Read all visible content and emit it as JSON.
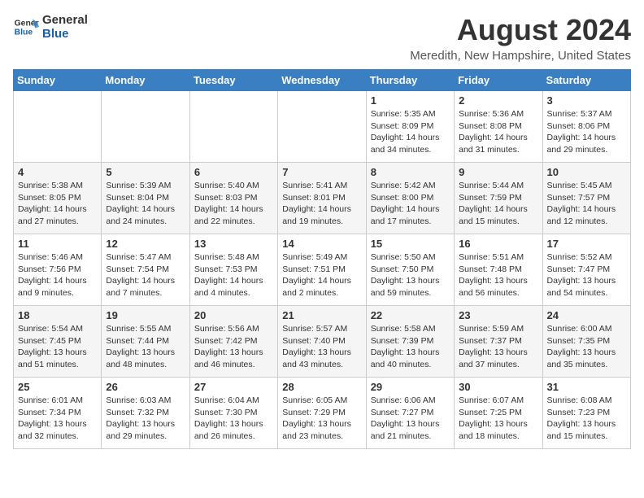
{
  "logo": {
    "line1": "General",
    "line2": "Blue"
  },
  "title": "August 2024",
  "location": "Meredith, New Hampshire, United States",
  "weekdays": [
    "Sunday",
    "Monday",
    "Tuesday",
    "Wednesday",
    "Thursday",
    "Friday",
    "Saturday"
  ],
  "weeks": [
    [
      {
        "day": "",
        "info": ""
      },
      {
        "day": "",
        "info": ""
      },
      {
        "day": "",
        "info": ""
      },
      {
        "day": "",
        "info": ""
      },
      {
        "day": "1",
        "info": "Sunrise: 5:35 AM\nSunset: 8:09 PM\nDaylight: 14 hours\nand 34 minutes."
      },
      {
        "day": "2",
        "info": "Sunrise: 5:36 AM\nSunset: 8:08 PM\nDaylight: 14 hours\nand 31 minutes."
      },
      {
        "day": "3",
        "info": "Sunrise: 5:37 AM\nSunset: 8:06 PM\nDaylight: 14 hours\nand 29 minutes."
      }
    ],
    [
      {
        "day": "4",
        "info": "Sunrise: 5:38 AM\nSunset: 8:05 PM\nDaylight: 14 hours\nand 27 minutes."
      },
      {
        "day": "5",
        "info": "Sunrise: 5:39 AM\nSunset: 8:04 PM\nDaylight: 14 hours\nand 24 minutes."
      },
      {
        "day": "6",
        "info": "Sunrise: 5:40 AM\nSunset: 8:03 PM\nDaylight: 14 hours\nand 22 minutes."
      },
      {
        "day": "7",
        "info": "Sunrise: 5:41 AM\nSunset: 8:01 PM\nDaylight: 14 hours\nand 19 minutes."
      },
      {
        "day": "8",
        "info": "Sunrise: 5:42 AM\nSunset: 8:00 PM\nDaylight: 14 hours\nand 17 minutes."
      },
      {
        "day": "9",
        "info": "Sunrise: 5:44 AM\nSunset: 7:59 PM\nDaylight: 14 hours\nand 15 minutes."
      },
      {
        "day": "10",
        "info": "Sunrise: 5:45 AM\nSunset: 7:57 PM\nDaylight: 14 hours\nand 12 minutes."
      }
    ],
    [
      {
        "day": "11",
        "info": "Sunrise: 5:46 AM\nSunset: 7:56 PM\nDaylight: 14 hours\nand 9 minutes."
      },
      {
        "day": "12",
        "info": "Sunrise: 5:47 AM\nSunset: 7:54 PM\nDaylight: 14 hours\nand 7 minutes."
      },
      {
        "day": "13",
        "info": "Sunrise: 5:48 AM\nSunset: 7:53 PM\nDaylight: 14 hours\nand 4 minutes."
      },
      {
        "day": "14",
        "info": "Sunrise: 5:49 AM\nSunset: 7:51 PM\nDaylight: 14 hours\nand 2 minutes."
      },
      {
        "day": "15",
        "info": "Sunrise: 5:50 AM\nSunset: 7:50 PM\nDaylight: 13 hours\nand 59 minutes."
      },
      {
        "day": "16",
        "info": "Sunrise: 5:51 AM\nSunset: 7:48 PM\nDaylight: 13 hours\nand 56 minutes."
      },
      {
        "day": "17",
        "info": "Sunrise: 5:52 AM\nSunset: 7:47 PM\nDaylight: 13 hours\nand 54 minutes."
      }
    ],
    [
      {
        "day": "18",
        "info": "Sunrise: 5:54 AM\nSunset: 7:45 PM\nDaylight: 13 hours\nand 51 minutes."
      },
      {
        "day": "19",
        "info": "Sunrise: 5:55 AM\nSunset: 7:44 PM\nDaylight: 13 hours\nand 48 minutes."
      },
      {
        "day": "20",
        "info": "Sunrise: 5:56 AM\nSunset: 7:42 PM\nDaylight: 13 hours\nand 46 minutes."
      },
      {
        "day": "21",
        "info": "Sunrise: 5:57 AM\nSunset: 7:40 PM\nDaylight: 13 hours\nand 43 minutes."
      },
      {
        "day": "22",
        "info": "Sunrise: 5:58 AM\nSunset: 7:39 PM\nDaylight: 13 hours\nand 40 minutes."
      },
      {
        "day": "23",
        "info": "Sunrise: 5:59 AM\nSunset: 7:37 PM\nDaylight: 13 hours\nand 37 minutes."
      },
      {
        "day": "24",
        "info": "Sunrise: 6:00 AM\nSunset: 7:35 PM\nDaylight: 13 hours\nand 35 minutes."
      }
    ],
    [
      {
        "day": "25",
        "info": "Sunrise: 6:01 AM\nSunset: 7:34 PM\nDaylight: 13 hours\nand 32 minutes."
      },
      {
        "day": "26",
        "info": "Sunrise: 6:03 AM\nSunset: 7:32 PM\nDaylight: 13 hours\nand 29 minutes."
      },
      {
        "day": "27",
        "info": "Sunrise: 6:04 AM\nSunset: 7:30 PM\nDaylight: 13 hours\nand 26 minutes."
      },
      {
        "day": "28",
        "info": "Sunrise: 6:05 AM\nSunset: 7:29 PM\nDaylight: 13 hours\nand 23 minutes."
      },
      {
        "day": "29",
        "info": "Sunrise: 6:06 AM\nSunset: 7:27 PM\nDaylight: 13 hours\nand 21 minutes."
      },
      {
        "day": "30",
        "info": "Sunrise: 6:07 AM\nSunset: 7:25 PM\nDaylight: 13 hours\nand 18 minutes."
      },
      {
        "day": "31",
        "info": "Sunrise: 6:08 AM\nSunset: 7:23 PM\nDaylight: 13 hours\nand 15 minutes."
      }
    ]
  ]
}
